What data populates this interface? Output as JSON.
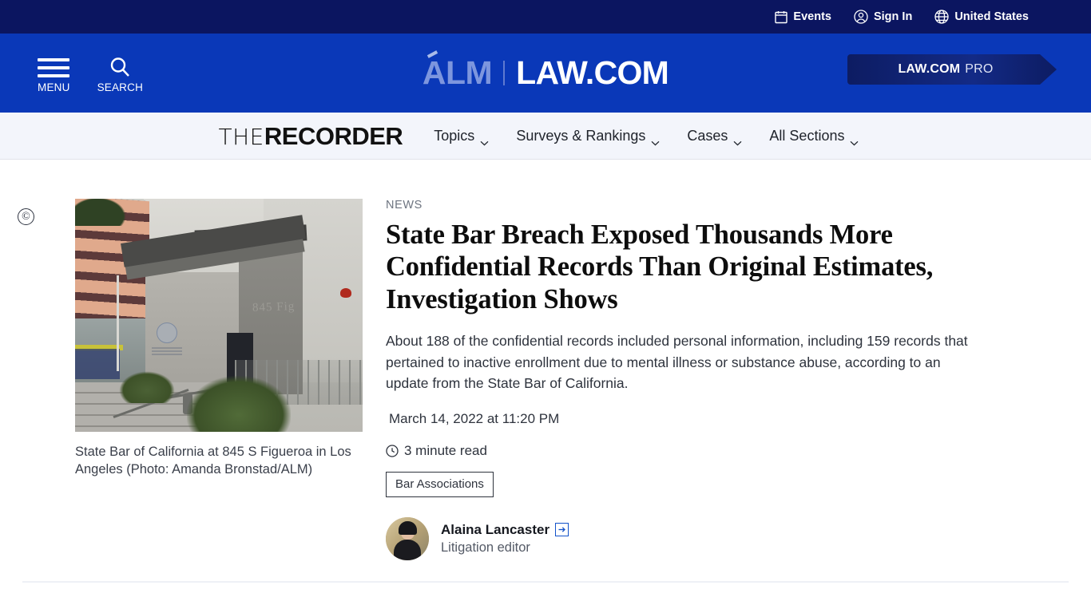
{
  "topbar": {
    "items": [
      {
        "label": "Events",
        "icon": "calendar-icon"
      },
      {
        "label": "Sign In",
        "icon": "user-circle-icon"
      },
      {
        "label": "United States",
        "icon": "globe-icon"
      }
    ]
  },
  "masthead": {
    "menu_label": "MENU",
    "search_label": "SEARCH",
    "logo_alm": "ALM",
    "logo_lawcom": "LAW.COM",
    "pro_bold": "LAW.COM",
    "pro_light": "PRO",
    "colors": {
      "topbar_bg": "#0b1560",
      "masthead_bg": "#0a38b8",
      "subnav_bg": "#f3f5fb",
      "pro_bg": "#0d1c62",
      "link_blue": "#1352c9"
    }
  },
  "subnav": {
    "brand_the": "THE",
    "brand_recorder": "RECORDER",
    "items": [
      {
        "label": "Topics"
      },
      {
        "label": "Surveys & Rankings"
      },
      {
        "label": "Cases"
      },
      {
        "label": "All Sections"
      }
    ]
  },
  "article": {
    "copyright_symbol": "©",
    "kicker": "NEWS",
    "headline": "State Bar Breach Exposed Thousands More Confidential Records Than Original Estimates, Investigation Shows",
    "deck": "About 188 of the confidential records included personal information, including 159 records that pertained to inactive enrollment due to mental illness or substance abuse, according to an update from the State Bar of California.",
    "pubdate": "March 14, 2022 at 11:20 PM",
    "readtime": "3 minute read",
    "tag": "Bar Associations",
    "photo_sign_text": "845 Fig",
    "caption": "State Bar of California at 845 S Figueroa in Los Angeles (Photo: Amanda Bronstad/ALM)",
    "author": {
      "name": "Alaina Lancaster",
      "role": "Litigation editor"
    }
  }
}
